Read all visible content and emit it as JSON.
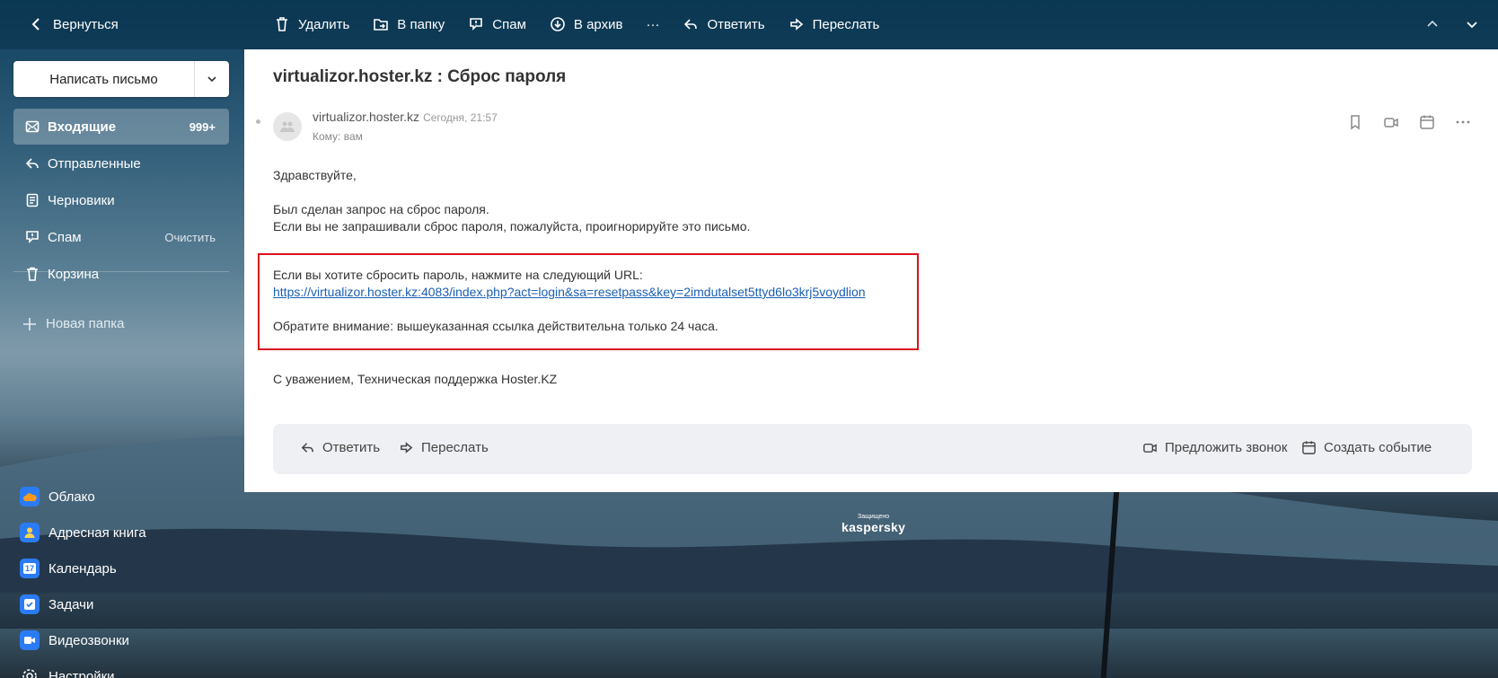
{
  "topbar": {
    "back_label": "Вернуться",
    "actions": [
      {
        "label": "Удалить",
        "icon": "trash-icon"
      },
      {
        "label": "В папку",
        "icon": "folder-move-icon"
      },
      {
        "label": "Спам",
        "icon": "spam-icon"
      },
      {
        "label": "В архив",
        "icon": "archive-icon"
      },
      {
        "label": "···",
        "icon": "more-icon"
      },
      {
        "label": "Ответить",
        "icon": "reply-icon"
      },
      {
        "label": "Переслать",
        "icon": "forward-icon"
      }
    ]
  },
  "sidebar": {
    "compose_label": "Написать письмо",
    "folders": [
      {
        "label": "Входящие",
        "badge": "999+",
        "icon": "inbox-icon"
      },
      {
        "label": "Отправленные",
        "icon": "sent-icon"
      },
      {
        "label": "Черновики",
        "icon": "drafts-icon"
      },
      {
        "label": "Спам",
        "aux": "Очистить",
        "icon": "spam-icon"
      },
      {
        "label": "Корзина",
        "icon": "trash-icon"
      }
    ],
    "new_folder_label": "Новая папка",
    "apps": [
      {
        "label": "Облако",
        "icon": "cloud-icon",
        "color": "#2a7cf6"
      },
      {
        "label": "Адресная книга",
        "icon": "contacts-icon",
        "color": "#2a7cf6"
      },
      {
        "label": "Календарь",
        "icon": "calendar-icon",
        "color": "#2a7cf6",
        "glyph": "17"
      },
      {
        "label": "Задачи",
        "icon": "tasks-icon",
        "color": "#2a7cf6"
      },
      {
        "label": "Видеозвонки",
        "icon": "video-icon",
        "color": "#2a7cf6"
      },
      {
        "label": "Настройки",
        "icon": "settings-icon"
      }
    ]
  },
  "message": {
    "subject": "virtualizor.hoster.kz : Сброс пароля",
    "sender": "virtualizor.hoster.kz",
    "date": "Сегодня, 21:57",
    "to": "Кому: вам",
    "greeting": "Здравствуйте,",
    "line1": "Был сделан запрос на сброс пароля.",
    "line2": "Если вы не запрашивали сброс пароля, пожалуйста, проигнорируйте это письмо.",
    "line3": "Если вы хотите сбросить пароль, нажмите на следующий URL:",
    "url": "https://virtualizor.hoster.kz:4083/index.php?act=login&sa=resetpass&key=2imdutalset5ttyd6lo3krj5voydlion",
    "notice": "Обратите внимание: вышеуказанная ссылка действительна только 24 часа.",
    "signature": "С уважением, Техническая поддержка Hoster.KZ",
    "highlight_color": "#d9111c"
  },
  "actions": {
    "reply": "Ответить",
    "forward": "Переслать",
    "call": "Предложить звонок",
    "event": "Создать событие"
  },
  "badge": {
    "small": "Защищено",
    "big": "kaspersky"
  }
}
